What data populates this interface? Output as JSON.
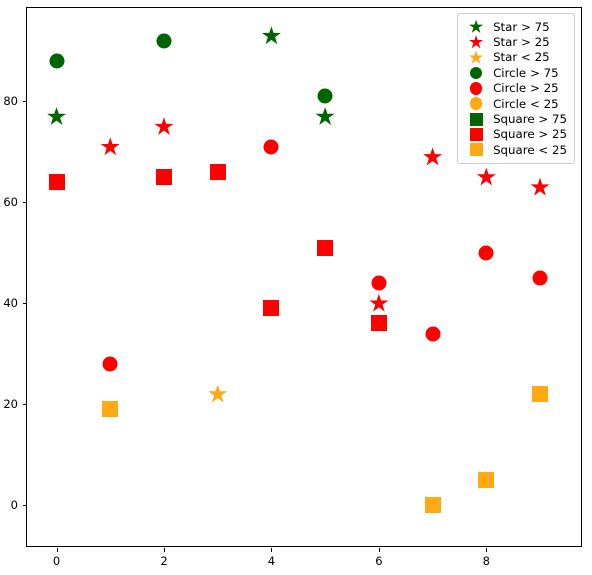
{
  "chart_data": {
    "type": "scatter",
    "title": "",
    "xlabel": "",
    "ylabel": "",
    "xlim": [
      -0.55,
      9.8
    ],
    "ylim": [
      -8.5,
      98.5
    ],
    "grid": false,
    "legend_position": "upper right",
    "x_ticks": [
      0,
      2,
      4,
      6,
      8
    ],
    "y_ticks": [
      0,
      20,
      40,
      60,
      80
    ],
    "x": [
      0,
      1,
      2,
      3,
      4,
      5,
      6,
      7,
      8,
      9
    ],
    "colors": {
      "green": "#006400",
      "red": "#ff0000",
      "orange": "#ffa914"
    },
    "series": [
      {
        "name": "Star",
        "shape": "star",
        "values": [
          77,
          71,
          75,
          22,
          93,
          77,
          40,
          69,
          65,
          63
        ],
        "colors": [
          "green",
          "red",
          "red",
          "orange",
          "green",
          "green",
          "red",
          "red",
          "red",
          "red"
        ]
      },
      {
        "name": "Circle",
        "shape": "circle",
        "values": [
          88,
          28,
          92,
          null,
          71,
          81,
          44,
          34,
          50,
          45
        ],
        "colors": [
          "green",
          "red",
          "green",
          null,
          "red",
          "green",
          "red",
          "red",
          "red",
          "red"
        ]
      },
      {
        "name": "Square",
        "shape": "square",
        "values": [
          64,
          19,
          65,
          66,
          39,
          51,
          36,
          0,
          5,
          22
        ],
        "colors": [
          "red",
          "orange",
          "red",
          "red",
          "red",
          "red",
          "red",
          "orange",
          "orange",
          "orange"
        ]
      }
    ],
    "legend": [
      {
        "label": "Star > 75",
        "shape": "star",
        "color": "green"
      },
      {
        "label": "Star > 25",
        "shape": "star",
        "color": "red"
      },
      {
        "label": "Star < 25",
        "shape": "star",
        "color": "orange"
      },
      {
        "label": "Circle > 75",
        "shape": "circle",
        "color": "green"
      },
      {
        "label": "Circle > 25",
        "shape": "circle",
        "color": "red"
      },
      {
        "label": "Circle < 25",
        "shape": "circle",
        "color": "orange"
      },
      {
        "label": "Square > 75",
        "shape": "square",
        "color": "green"
      },
      {
        "label": "Square > 25",
        "shape": "square",
        "color": "red"
      },
      {
        "label": "Square < 25",
        "shape": "square",
        "color": "orange"
      }
    ]
  }
}
